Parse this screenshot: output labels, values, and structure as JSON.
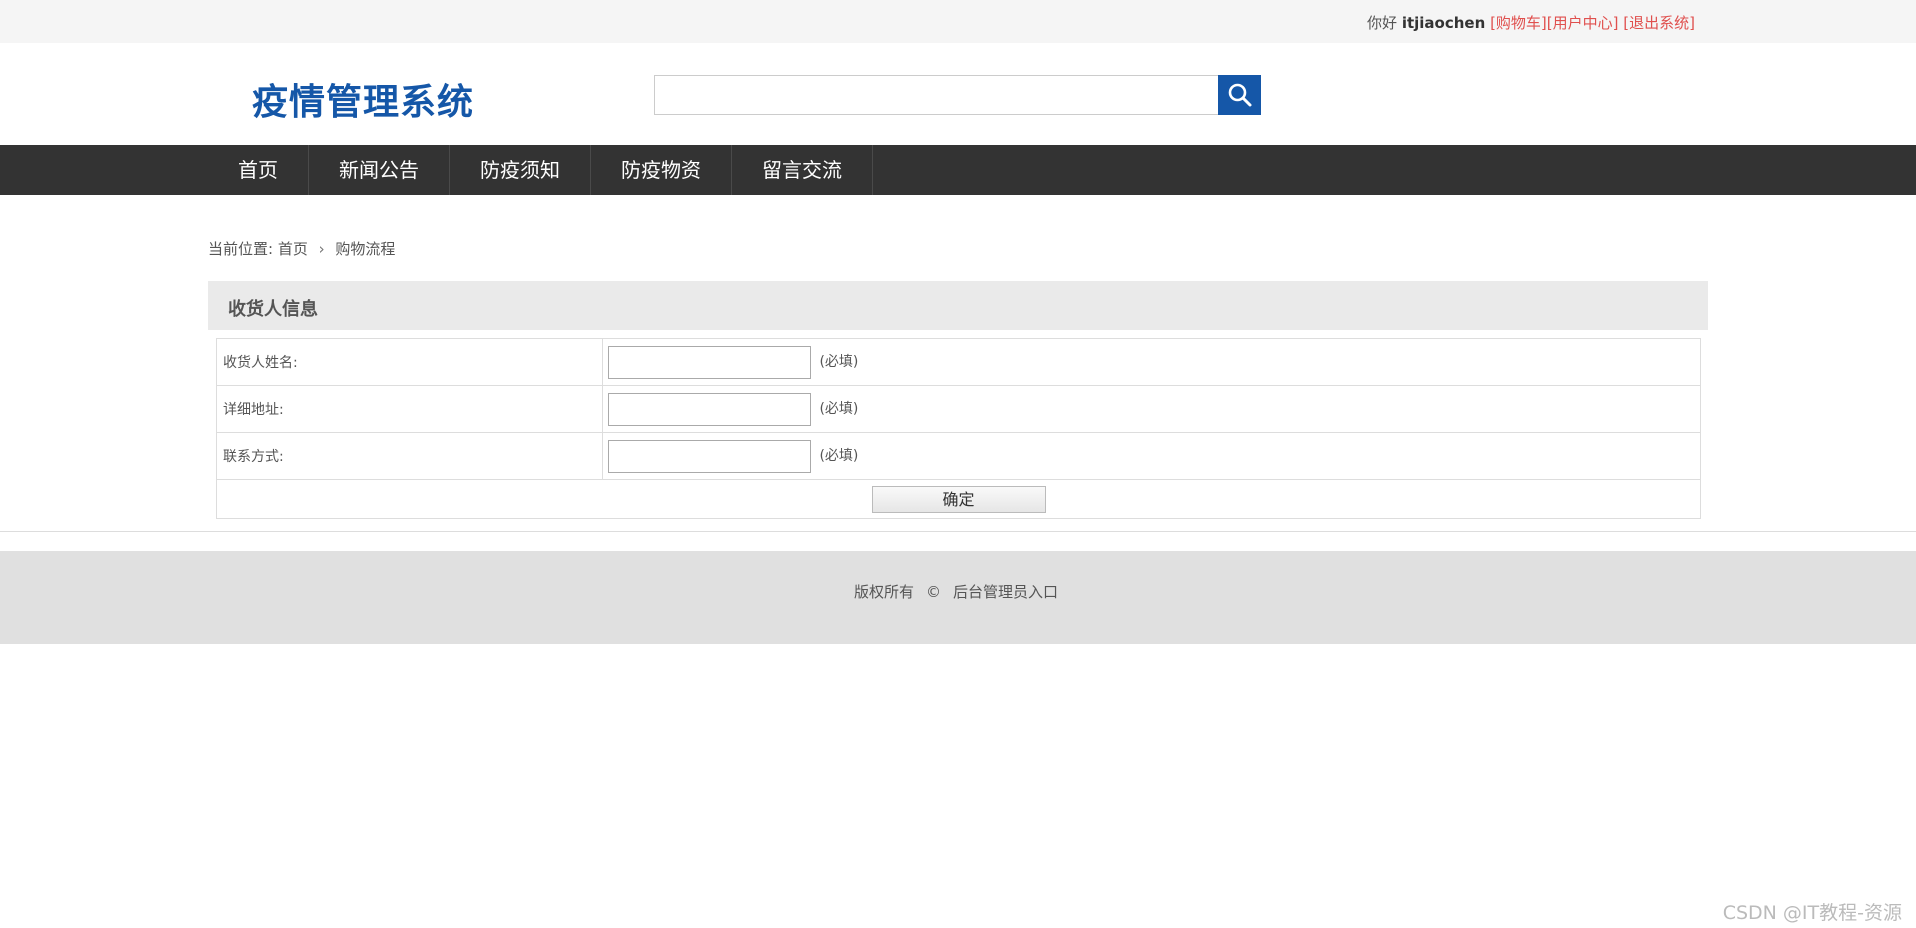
{
  "topbar": {
    "greeting": "你好",
    "username": "itjiaochen",
    "links": [
      "[购物车]",
      "[用户中心]",
      "[退出系统]"
    ]
  },
  "header": {
    "logo": "疫情管理系统",
    "search": {
      "value": "",
      "placeholder": ""
    },
    "search_icon": "search-icon"
  },
  "nav": {
    "items": [
      "首页",
      "新闻公告",
      "防疫须知",
      "防疫物资",
      "留言交流"
    ]
  },
  "breadcrumb": {
    "prefix": "当前位置:",
    "home": "首页",
    "separator": ">",
    "current": "购物流程"
  },
  "section": {
    "title": "收货人信息",
    "fields": [
      {
        "label": "收货人姓名:",
        "value": "",
        "hint": "(必填)"
      },
      {
        "label": "详细地址:",
        "value": "",
        "hint": "(必填)"
      },
      {
        "label": "联系方式:",
        "value": "",
        "hint": "(必填)"
      }
    ],
    "submit_label": "确定"
  },
  "footer": {
    "copyright": "版权所有",
    "copy_symbol": "©",
    "admin_link": "后台管理员入口"
  },
  "watermark": "CSDN @IT教程-资源",
  "colors": {
    "brand": "#1557a8",
    "nav_bg": "#333333",
    "link_red": "#e0504e"
  }
}
